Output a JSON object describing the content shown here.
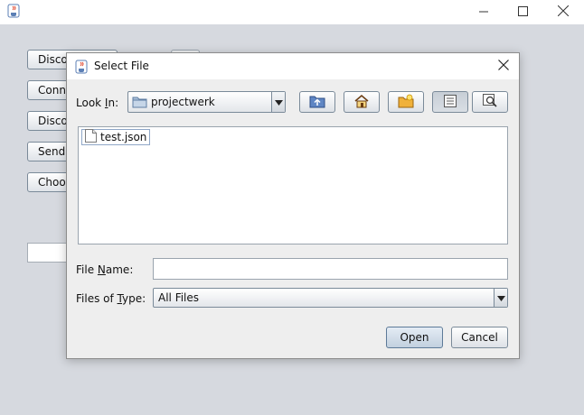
{
  "main_window": {
    "title": "",
    "icons": {
      "app": "java-cup-icon",
      "minimize": "minimize-icon",
      "maximize": "maximize-icon",
      "close": "close-icon"
    },
    "buttons": [
      {
        "label": "Disco"
      },
      {
        "label": "Conn"
      },
      {
        "label": "Disco"
      },
      {
        "label": "Send"
      },
      {
        "label": "Choo"
      }
    ]
  },
  "dialog": {
    "title": "Select File",
    "look_in": {
      "label_prefix": "Look ",
      "label_mnemonic": "I",
      "label_suffix": "n:",
      "value": "projectwerk"
    },
    "toolbar": {
      "up_folder": "up-folder-icon",
      "home": "home-icon",
      "new_folder": "new-folder-icon",
      "list_view": "list-view-icon",
      "details_view": "details-view-icon"
    },
    "files": [
      {
        "name": "test.json"
      }
    ],
    "file_name": {
      "label_prefix": "File ",
      "label_mnemonic": "N",
      "label_suffix": "ame:",
      "value": ""
    },
    "file_type": {
      "label_prefix": "Files of ",
      "label_mnemonic": "T",
      "label_suffix": "ype:",
      "value": "All Files"
    },
    "open_label": "Open",
    "cancel_label": "Cancel"
  },
  "colors": {
    "background": "#d6d9df",
    "dialog_bg": "#eeeeee",
    "border": "#7a8a99"
  }
}
